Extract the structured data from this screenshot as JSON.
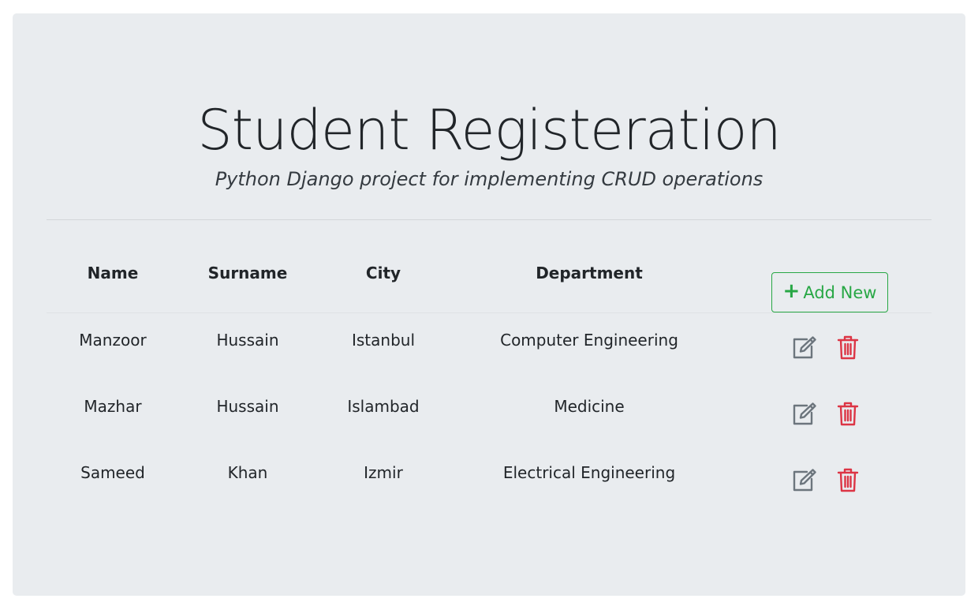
{
  "header": {
    "title": "Student Registeration",
    "subtitle": "Python Django project for implementing CRUD operations"
  },
  "table": {
    "columns": [
      "Name",
      "Surname",
      "City",
      "Department"
    ],
    "add_button_label": "Add New",
    "rows": [
      {
        "name": "Manzoor",
        "surname": "Hussain",
        "city": "Istanbul",
        "department": "Computer Engineering"
      },
      {
        "name": "Mazhar",
        "surname": "Hussain",
        "city": "Islambad",
        "department": "Medicine"
      },
      {
        "name": "Sameed",
        "surname": "Khan",
        "city": "Izmir",
        "department": "Electrical Engineering"
      }
    ]
  },
  "icons": {
    "add": "plus-icon",
    "edit": "edit-icon",
    "delete": "trash-icon"
  },
  "colors": {
    "background": "#e9ecef",
    "success": "#28a745",
    "danger": "#dc3545",
    "secondary": "#6c757d"
  }
}
